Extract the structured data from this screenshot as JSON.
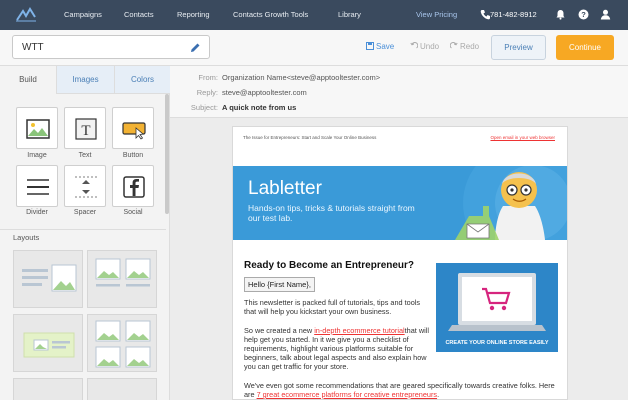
{
  "topnav": {
    "items": [
      "Campaigns",
      "Contacts",
      "Reporting",
      "Contacts Growth Tools",
      "Library"
    ],
    "view_pricing": "View Pricing",
    "phone": "781-482-8912",
    "icons": [
      "logo-icon",
      "phone-icon",
      "bell-icon",
      "help-icon",
      "user-icon"
    ]
  },
  "toolbar": {
    "name_value": "WTT",
    "save": "Save",
    "undo": "Undo",
    "redo": "Redo",
    "preview": "Preview",
    "continue": "Continue",
    "colors": {
      "accent": "#f7a823",
      "save_blue": "#4a8fd8"
    }
  },
  "left": {
    "tabs": [
      "Build",
      "Images",
      "Colors"
    ],
    "blocks": [
      "Image",
      "Text",
      "Button",
      "Divider",
      "Spacer",
      "Social"
    ],
    "layouts_label": "Layouts"
  },
  "meta": {
    "from_label": "From:",
    "from_value": "Organization Name<steve@apptooltester.com>",
    "reply_label": "Reply:",
    "reply_value": "steve@apptooltester.com",
    "subject_label": "Subject:",
    "subject_value": "A quick note from us"
  },
  "email": {
    "preheader": "The Issue for Entrepreneurs: Start and Scale Your Online Business",
    "open_link": "Open email in your web browser",
    "banner_title": "Labletter",
    "banner_subtitle": "Hands-on tips, tricks & tutorials straight from our test lab.",
    "heading": "Ready to Become an Entrepreneur?",
    "hello": "Hello {First Name},",
    "p1": "This newsletter is packed full of tutorials, tips and tools that will help you kickstart your own business.",
    "p2_pre": "So we created a new ",
    "p2_link": "in-depth ecommerce tutorial",
    "p2_post": "that will help get you started. In it we give you a checklist of requirements, highlight various platforms suitable for beginners, talk about legal aspects and also explain how you can get traffic for your store.",
    "p3_pre": "We've even got some recommendations that are geared specifically towards creative folks. Here are ",
    "p3_link": "7 great ecommerce platforms for creative entrepreneurs",
    "p3_post": ".",
    "promo_caption": "CREATE YOUR ONLINE STORE EASILY"
  }
}
